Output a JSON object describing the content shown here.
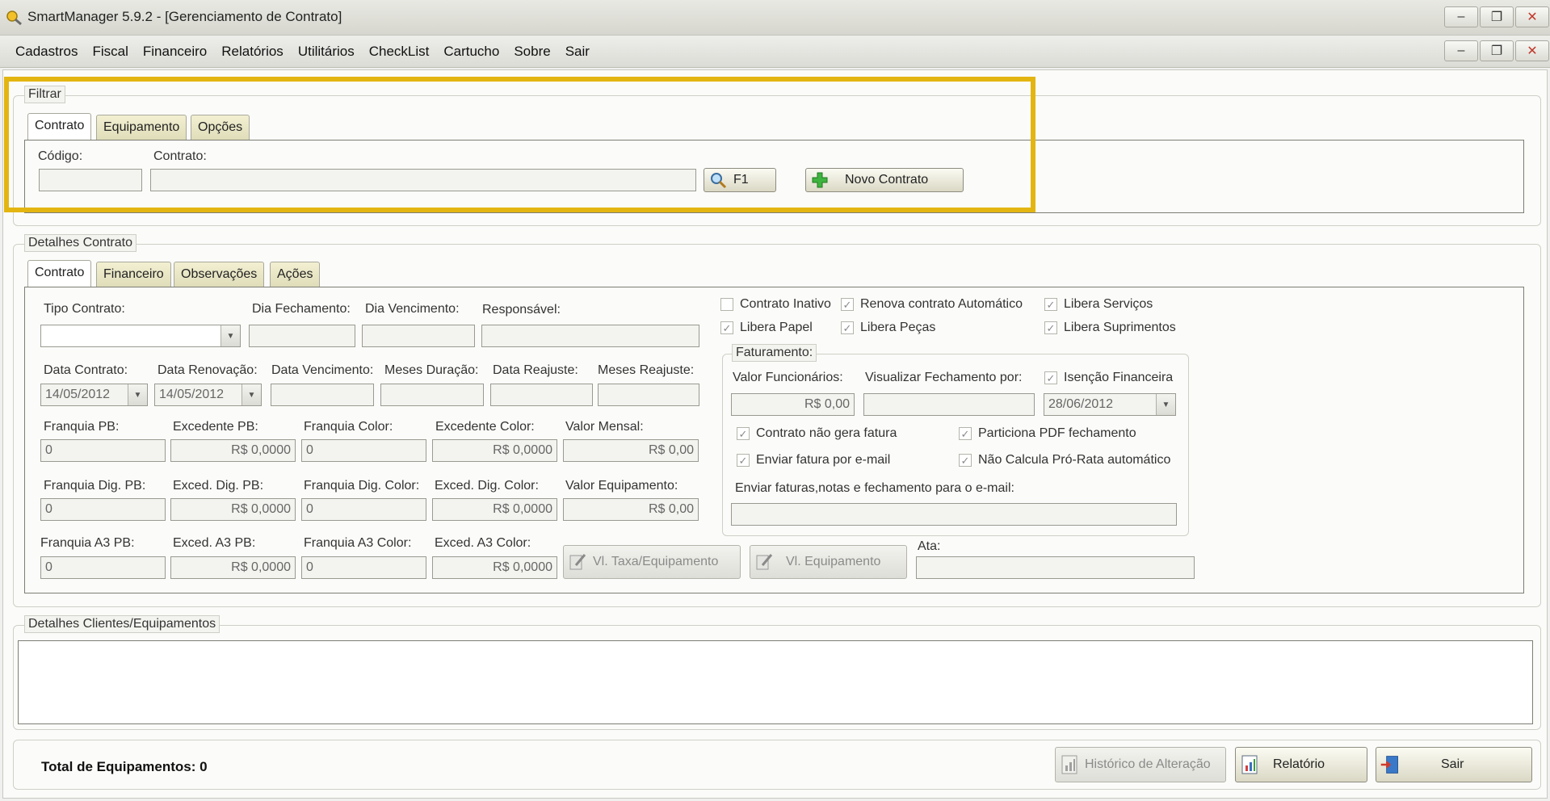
{
  "window": {
    "title": "SmartManager 5.9.2 - [Gerenciamento de Contrato]",
    "min": "–",
    "restore": "❐",
    "close": "✕"
  },
  "menu": [
    "Cadastros",
    "Fiscal",
    "Financeiro",
    "Relatórios",
    "Utilitários",
    "CheckList",
    "Cartucho",
    "Sobre",
    "Sair"
  ],
  "filtrar": {
    "legend": "Filtrar",
    "tabs": [
      "Contrato",
      "Equipamento",
      "Opções"
    ],
    "codigo_label": "Código:",
    "contrato_label": "Contrato:",
    "codigo_value": "",
    "contrato_value": "",
    "search_button": "F1",
    "novo_button": "Novo Contrato"
  },
  "detalhes": {
    "legend": "Detalhes Contrato",
    "tabs": [
      "Contrato",
      "Financeiro",
      "Observações",
      "Ações"
    ],
    "tipo_contrato": {
      "label": "Tipo Contrato:",
      "value": ""
    },
    "dia_fechamento": {
      "label": "Dia Fechamento:",
      "value": ""
    },
    "dia_vencimento": {
      "label": "Dia Vencimento:",
      "value": ""
    },
    "responsavel": {
      "label": "Responsável:",
      "value": ""
    },
    "data_contrato": {
      "label": "Data Contrato:",
      "value": "14/05/2012"
    },
    "data_renovacao": {
      "label": "Data Renovação:",
      "value": "14/05/2012"
    },
    "data_vencimento": {
      "label": "Data Vencimento:",
      "value": ""
    },
    "meses_duracao": {
      "label": "Meses Duração:",
      "value": ""
    },
    "data_reajuste": {
      "label": "Data Reajuste:",
      "value": ""
    },
    "meses_reajuste": {
      "label": "Meses Reajuste:",
      "value": ""
    },
    "franquia_pb": {
      "label": "Franquia PB:",
      "value": "0"
    },
    "excedente_pb": {
      "label": "Excedente PB:",
      "value": "R$ 0,0000"
    },
    "franquia_color": {
      "label": "Franquia Color:",
      "value": "0"
    },
    "excedente_color": {
      "label": "Excedente Color:",
      "value": "R$ 0,0000"
    },
    "valor_mensal": {
      "label": "Valor Mensal:",
      "value": "R$ 0,00"
    },
    "franquia_dig_pb": {
      "label": "Franquia Dig. PB:",
      "value": "0"
    },
    "exced_dig_pb": {
      "label": "Exced. Dig. PB:",
      "value": "R$ 0,0000"
    },
    "franquia_dig_color": {
      "label": "Franquia Dig. Color:",
      "value": "0"
    },
    "exced_dig_color": {
      "label": "Exced. Dig. Color:",
      "value": "R$ 0,0000"
    },
    "valor_equipamento": {
      "label": "Valor Equipamento:",
      "value": "R$ 0,00"
    },
    "franquia_a3_pb": {
      "label": "Franquia A3 PB:",
      "value": "0"
    },
    "exced_a3_pb": {
      "label": "Exced. A3 PB:",
      "value": "R$ 0,0000"
    },
    "franquia_a3_color": {
      "label": "Franquia A3 Color:",
      "value": "0"
    },
    "exced_a3_color": {
      "label": "Exced. A3 Color:",
      "value": "R$ 0,0000"
    },
    "vl_taxa_button": "Vl. Taxa/Equipamento",
    "vl_equip_button": "Vl. Equipamento",
    "ata": {
      "label": "Ata:",
      "value": ""
    },
    "checks": {
      "contrato_inativo": "Contrato Inativo",
      "renova_automatico": "Renova contrato Automático",
      "libera_servicos": "Libera Serviços",
      "libera_papel": "Libera Papel",
      "libera_pecas": "Libera Peças",
      "libera_suprimentos": "Libera Suprimentos"
    },
    "check_mark": "✓",
    "faturamento": {
      "legend": "Faturamento:",
      "valor_funcionarios": {
        "label": "Valor Funcionários:",
        "value": "R$ 0,00"
      },
      "visualizar_fechamento": {
        "label": "Visualizar Fechamento por:",
        "value": ""
      },
      "isencao": "Isenção Financeira",
      "isencao_date": "28/06/2012",
      "nao_gera_fatura": "Contrato não gera fatura",
      "particiona_pdf": "Particiona PDF fechamento",
      "enviar_email": "Enviar fatura por e-mail",
      "nao_calcula": "Não Calcula Pró-Rata automático",
      "email_label": "Enviar faturas,notas e fechamento para o e-mail:",
      "email_value": ""
    }
  },
  "clientes": {
    "legend": "Detalhes Clientes/Equipamentos"
  },
  "footer": {
    "total_label": "Total de Equipamentos: 0",
    "historico_button": "Histórico de Alteração",
    "relatorio_button": "Relatório",
    "sair_button": "Sair"
  },
  "colors": {
    "highlight": "#e3b511",
    "tab": "#e6e3c4"
  }
}
